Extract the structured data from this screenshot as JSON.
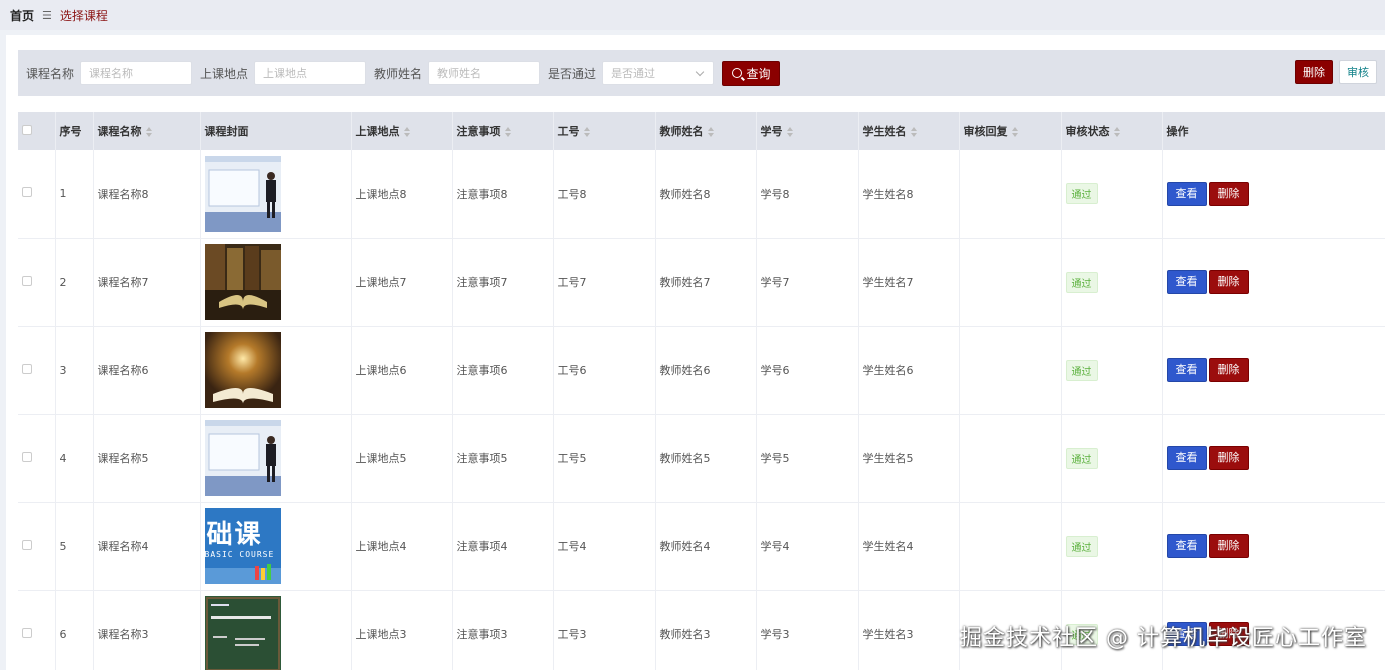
{
  "breadcrumb": {
    "home": "首页",
    "separator_icon": "menu-icon",
    "current": "选择课程"
  },
  "search": {
    "course_name_label": "课程名称",
    "course_name_placeholder": "课程名称",
    "location_label": "上课地点",
    "location_placeholder": "上课地点",
    "teacher_label": "教师姓名",
    "teacher_placeholder": "教师姓名",
    "passed_label": "是否通过",
    "passed_placeholder": "是否通过",
    "query_button": "查询"
  },
  "actions": {
    "delete_button": "删除",
    "audit_button": "审核"
  },
  "table": {
    "headers": [
      "序号",
      "课程名称",
      "课程封面",
      "上课地点",
      "注意事项",
      "工号",
      "教师姓名",
      "学号",
      "学生姓名",
      "审核回复",
      "审核状态",
      "操作"
    ],
    "view_label": "查看",
    "delete_label": "删除",
    "rows": [
      {
        "index": "1",
        "course": "课程名称8",
        "cover": "teacher-slide",
        "location": "上课地点8",
        "notes": "注意事项8",
        "staff_id": "工号8",
        "teacher": "教师姓名8",
        "student_id": "学号8",
        "student": "学生姓名8",
        "reply": "",
        "status": "通过"
      },
      {
        "index": "2",
        "course": "课程名称7",
        "cover": "open-book",
        "location": "上课地点7",
        "notes": "注意事项7",
        "staff_id": "工号7",
        "teacher": "教师姓名7",
        "student_id": "学号7",
        "student": "学生姓名7",
        "reply": "",
        "status": "通过"
      },
      {
        "index": "3",
        "course": "课程名称6",
        "cover": "glowing-book",
        "location": "上课地点6",
        "notes": "注意事项6",
        "staff_id": "工号6",
        "teacher": "教师姓名6",
        "student_id": "学号6",
        "student": "学生姓名6",
        "reply": "",
        "status": "通过"
      },
      {
        "index": "4",
        "course": "课程名称5",
        "cover": "teacher-slide",
        "location": "上课地点5",
        "notes": "注意事项5",
        "staff_id": "工号5",
        "teacher": "教师姓名5",
        "student_id": "学号5",
        "student": "学生姓名5",
        "reply": "",
        "status": "通过"
      },
      {
        "index": "5",
        "course": "课程名称4",
        "cover": "basic-course",
        "cover_text": "础课",
        "cover_subtext": "BASIC COURSE",
        "location": "上课地点4",
        "notes": "注意事项4",
        "staff_id": "工号4",
        "teacher": "教师姓名4",
        "student_id": "学号4",
        "student": "学生姓名4",
        "reply": "",
        "status": "通过"
      },
      {
        "index": "6",
        "course": "课程名称3",
        "cover": "chalkboard",
        "location": "上课地点3",
        "notes": "注意事项3",
        "staff_id": "工号3",
        "teacher": "教师姓名3",
        "student_id": "学号3",
        "student": "学生姓名3",
        "reply": "",
        "status": "通过"
      }
    ]
  },
  "watermark": "掘金技术社区 @ 计算机毕设匠心工作室",
  "colors": {
    "primary_red": "#8b0000",
    "view_blue": "#2f58cd",
    "pass_green": "#5ab03c",
    "header_bg": "#dfe2ea"
  }
}
